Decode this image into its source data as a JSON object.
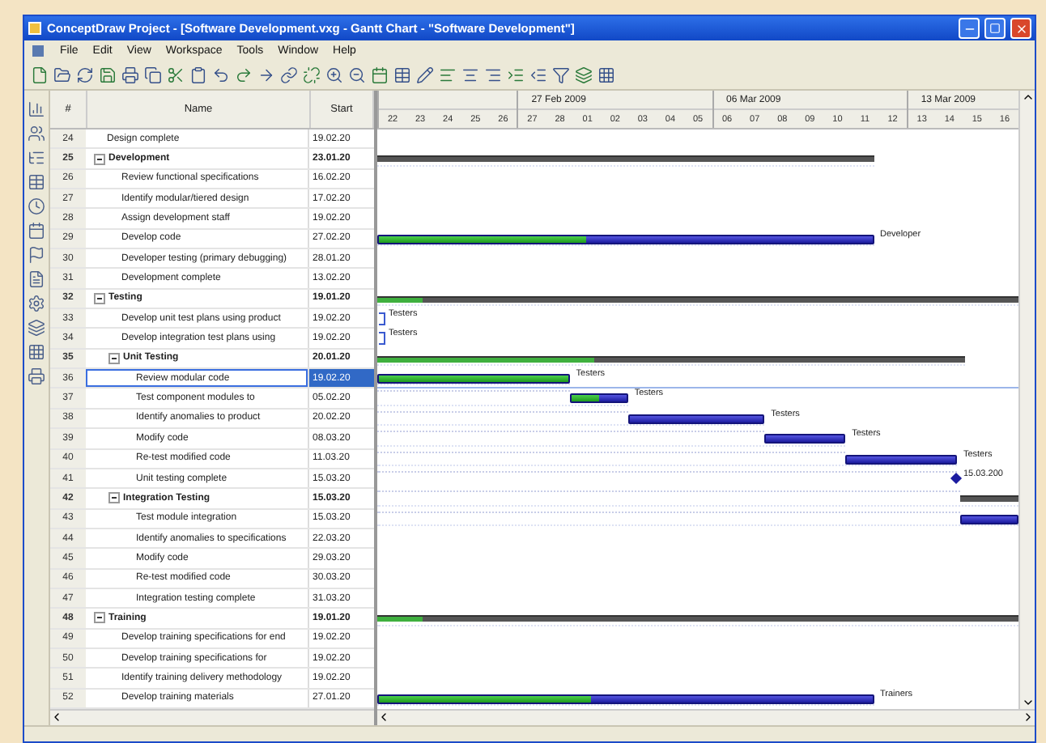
{
  "window": {
    "title": "ConceptDraw Project - [Software Development.vxg - Gantt Chart - \"Software Development\"]"
  },
  "menu": [
    "File",
    "Edit",
    "View",
    "Workspace",
    "Tools",
    "Window",
    "Help"
  ],
  "table": {
    "columns": [
      "#",
      "Name",
      "Start"
    ],
    "rows": [
      {
        "number": "24",
        "name": "Design complete",
        "start": "19.02.20",
        "kind": "task",
        "selected": false
      },
      {
        "number": "25",
        "name": "Development",
        "start": "23.01.20",
        "kind": "summary",
        "selected": false,
        "expanded": true,
        "bar": {
          "kind": "summary",
          "end": {
            "level": 0.774
          }
        },
        "children": [
          {
            "number": "26",
            "name": "Review functional specifications",
            "start": "16.02.20",
            "kind": "task",
            "selected": false
          },
          {
            "number": "27",
            "name": "Identify modular/tiered design",
            "start": "17.02.20",
            "kind": "task",
            "selected": false
          },
          {
            "number": "28",
            "name": "Assign development staff",
            "start": "19.02.20",
            "kind": "task",
            "selected": false
          },
          {
            "number": "29",
            "name": "Develop code",
            "start": "27.02.20",
            "kind": "task",
            "selected": false,
            "bar": {
              "kind": "task",
              "end": {
                "level": 0.774
              },
              "level": 0.42,
              "label": "Developer"
            }
          },
          {
            "number": "30",
            "name": "Developer testing (primary debugging)",
            "start": "28.01.20",
            "kind": "task",
            "selected": false
          },
          {
            "number": "31",
            "name": "Development complete",
            "start": "13.02.20",
            "kind": "task",
            "selected": false
          }
        ]
      },
      {
        "number": "32",
        "name": "Testing",
        "start": "19.01.20",
        "kind": "summary",
        "selected": false,
        "expanded": true,
        "bar": {
          "kind": "summary",
          "end": {
            "level": 1
          },
          "level": 0.07
        },
        "children": [
          {
            "number": "33",
            "name": "Develop unit test plans using product",
            "start": "19.02.20",
            "kind": "task",
            "selected": false,
            "bar": {
              "kind": "note",
              "label": "Testers"
            }
          },
          {
            "number": "34",
            "name": "Develop integration test plans using",
            "start": "19.02.20",
            "kind": "task",
            "selected": false,
            "bar": {
              "kind": "note",
              "label": "Testers"
            }
          },
          {
            "number": "35",
            "name": "Unit Testing",
            "start": "20.01.20",
            "kind": "summary",
            "selected": false,
            "expanded": true,
            "bar": {
              "kind": "summary",
              "end": {
                "level": 0.917
              },
              "level": 0.37
            },
            "children": [
              {
                "number": "36",
                "name": "Review modular code",
                "start": "19.02.20",
                "kind": "task",
                "selected": true,
                "bar": {
                  "kind": "task",
                  "end": {
                    "level": 0.3
                  },
                  "level": 1,
                  "label": "Testers"
                }
              },
              {
                "number": "37",
                "name": "Test component modules to",
                "start": "05.02.20",
                "kind": "task",
                "selected": false,
                "bar": {
                  "kind": "task",
                  "start": {
                    "level": 0.3
                  },
                  "end": {
                    "level": 0.391
                  },
                  "level": 0.5,
                  "label": "Testers"
                }
              },
              {
                "number": "38",
                "name": "Identify anomalies to product",
                "start": "20.02.20",
                "kind": "task",
                "selected": false,
                "bar": {
                  "kind": "task",
                  "start": {
                    "level": 0.391
                  },
                  "end": {
                    "level": 0.604
                  },
                  "label": "Testers"
                }
              },
              {
                "number": "39",
                "name": "Modify code",
                "start": "08.03.20",
                "kind": "task",
                "selected": false,
                "bar": {
                  "kind": "task",
                  "start": {
                    "level": 0.604
                  },
                  "end": {
                    "level": 0.73
                  },
                  "label": "Testers"
                }
              },
              {
                "number": "40",
                "name": "Re-test modified code",
                "start": "11.03.20",
                "kind": "task",
                "selected": false,
                "bar": {
                  "kind": "task",
                  "start": {
                    "level": 0.73
                  },
                  "end": {
                    "level": 0.904
                  },
                  "label": "Testers"
                }
              },
              {
                "number": "41",
                "name": "Unit testing complete",
                "start": "15.03.20",
                "kind": "task",
                "selected": false,
                "bar": {
                  "kind": "milestone",
                  "start": {
                    "level": 0.904
                  },
                  "label": "15.03.200"
                }
              }
            ]
          },
          {
            "number": "42",
            "name": "Integration Testing",
            "start": "15.03.20",
            "kind": "summary",
            "selected": false,
            "expanded": true,
            "bar": {
              "kind": "summary",
              "start": {
                "level": 0.909
              },
              "end": {
                "level": 1
              }
            },
            "children": [
              {
                "number": "43",
                "name": "Test module integration",
                "start": "15.03.20",
                "kind": "task",
                "selected": false,
                "bar": {
                  "kind": "task",
                  "start": {
                    "level": 0.909
                  },
                  "end": {
                    "level": 1
                  }
                }
              },
              {
                "number": "44",
                "name": "Identify anomalies to specifications",
                "start": "22.03.20",
                "kind": "task",
                "selected": false
              },
              {
                "number": "45",
                "name": "Modify code",
                "start": "29.03.20",
                "kind": "task",
                "selected": false
              },
              {
                "number": "46",
                "name": "Re-test modified code",
                "start": "30.03.20",
                "kind": "task",
                "selected": false
              },
              {
                "number": "47",
                "name": "Integration testing complete",
                "start": "31.03.20",
                "kind": "task",
                "selected": false
              }
            ]
          }
        ]
      },
      {
        "number": "48",
        "name": "Training",
        "start": "19.01.20",
        "kind": "summary",
        "selected": false,
        "expanded": true,
        "bar": {
          "kind": "summary",
          "end": {
            "level": 1
          },
          "level": 0.07
        },
        "children": [
          {
            "number": "49",
            "name": "Develop training specifications for end",
            "start": "19.02.20",
            "kind": "task",
            "selected": false
          },
          {
            "number": "50",
            "name": "Develop training specifications for",
            "start": "19.02.20",
            "kind": "task",
            "selected": false
          },
          {
            "number": "51",
            "name": "Identify training delivery methodology",
            "start": "19.02.20",
            "kind": "task",
            "selected": false
          },
          {
            "number": "52",
            "name": "Develop training materials",
            "start": "27.01.20",
            "kind": "task",
            "selected": false,
            "bar": {
              "kind": "task",
              "end": {
                "level": 0.774
              },
              "level": 0.43,
              "label": "Trainers"
            }
          }
        ]
      }
    ]
  },
  "timeline": {
    "weeks": [
      {
        "days": [
          "22",
          "23",
          "24",
          "25",
          "26"
        ]
      },
      {
        "label": "27 Feb 2009",
        "days": [
          "27",
          "28",
          "01",
          "02",
          "03",
          "04",
          "05"
        ]
      },
      {
        "label": "06 Mar 2009",
        "days": [
          "06",
          "07",
          "08",
          "09",
          "10",
          "11",
          "12"
        ]
      },
      {
        "label": "13 Mar 2009",
        "days": [
          "13",
          "14",
          "15",
          "16"
        ]
      }
    ]
  }
}
